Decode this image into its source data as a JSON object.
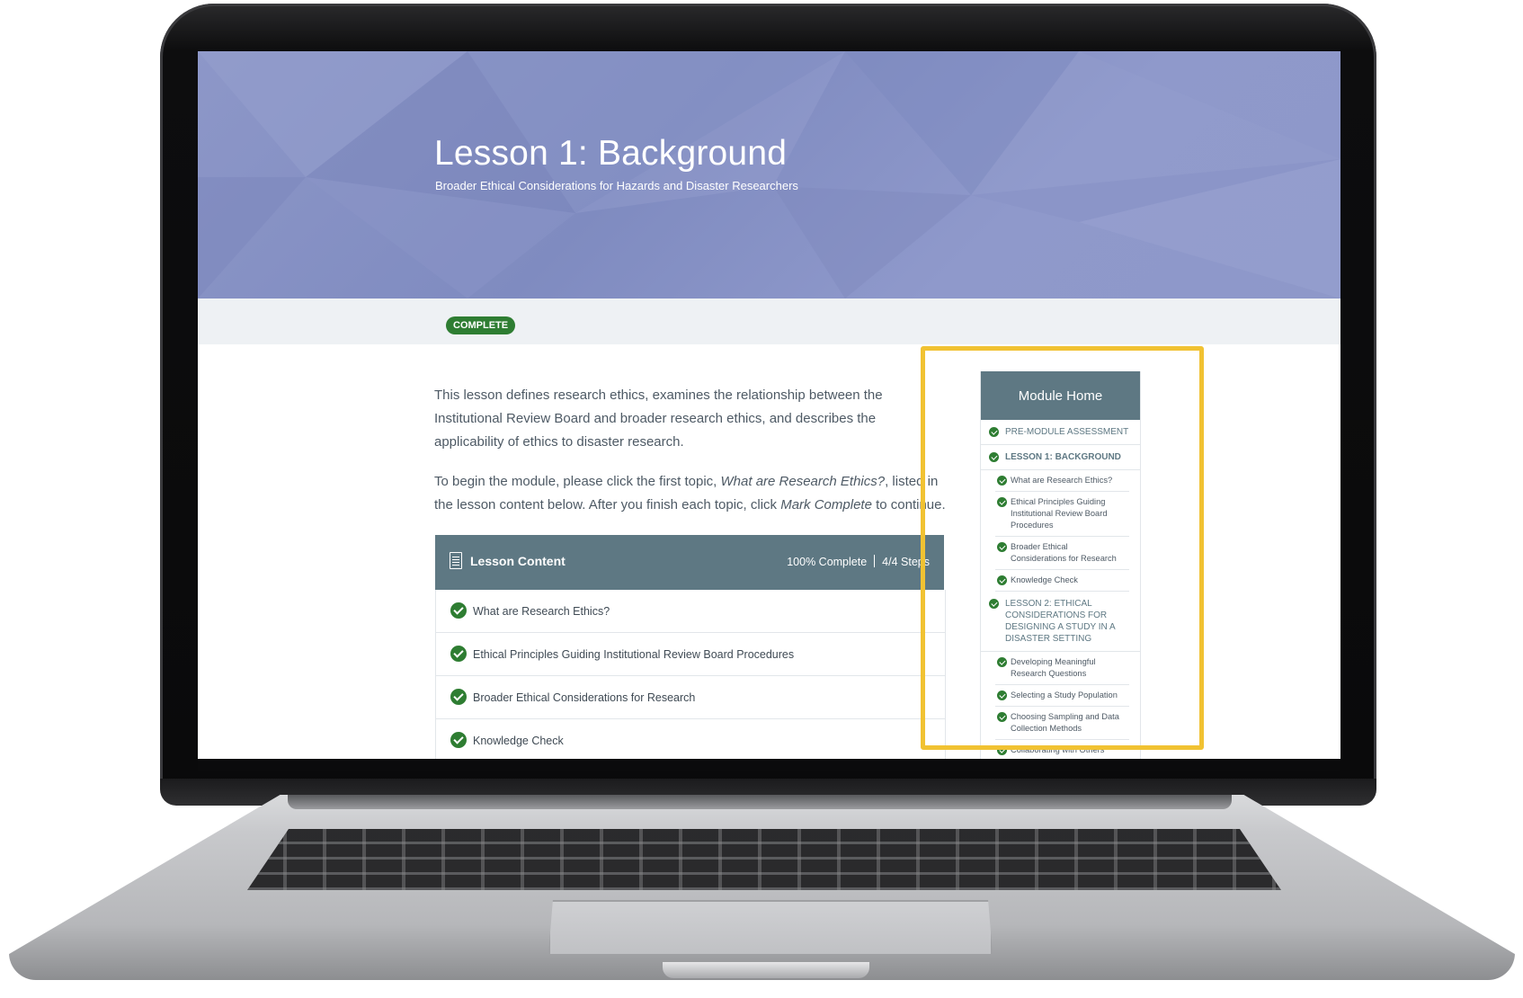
{
  "hero": {
    "title": "Lesson 1: Background",
    "subtitle": "Broader Ethical Considerations for Hazards and Disaster Researchers"
  },
  "status_badge": "COMPLETE",
  "intro": {
    "p1": "This lesson defines research ethics, examines the relationship between the Institutional Review Board and broader research ethics, and describes the applicability of ethics to disaster research.",
    "p2_before": "To begin the module, please click the first topic, ",
    "p2_topic": "What are Research Ethics?",
    "p2_middle": ", listed in the lesson content below. After you finish each topic, click ",
    "p2_action": "Mark Complete",
    "p2_after": " to continue."
  },
  "lesson_content": {
    "title": "Lesson Content",
    "progress_text": "100% Complete",
    "steps_text": "4/4 Steps",
    "progress_fraction": 1.0,
    "items": [
      "What are Research Ethics?",
      "Ethical Principles Guiding Institutional Review Board Procedures",
      "Broader Ethical Considerations for Research",
      "Knowledge Check"
    ]
  },
  "sidebar": {
    "title": "Module Home",
    "items": [
      {
        "label": "PRE-MODULE ASSESSMENT",
        "level": "main"
      },
      {
        "label": "LESSON 1: BACKGROUND",
        "level": "main",
        "active": true
      },
      {
        "label": "What are Research Ethics?",
        "level": "sub"
      },
      {
        "label": "Ethical Principles Guiding Institutional Review Board Procedures",
        "level": "sub"
      },
      {
        "label": "Broader Ethical Considerations for Research",
        "level": "sub"
      },
      {
        "label": "Knowledge Check",
        "level": "sub"
      },
      {
        "label": "LESSON 2: ETHICAL CONSIDERATIONS FOR DESIGNING A STUDY IN A DISASTER SETTING",
        "level": "main"
      },
      {
        "label": "Developing Meaningful Research Questions",
        "level": "sub"
      },
      {
        "label": "Selecting a Study Population",
        "level": "sub"
      },
      {
        "label": "Choosing Sampling and Data Collection Methods",
        "level": "sub"
      },
      {
        "label": "Collaborating with Others",
        "level": "sub"
      }
    ]
  },
  "colors": {
    "hero_bg": "#8d97c8",
    "header_bg": "#5e7883",
    "complete_green": "#2e7d32",
    "highlight": "#f1c232"
  },
  "icons": {
    "check": "check-circle-icon",
    "lesson_content": "document-icon"
  }
}
